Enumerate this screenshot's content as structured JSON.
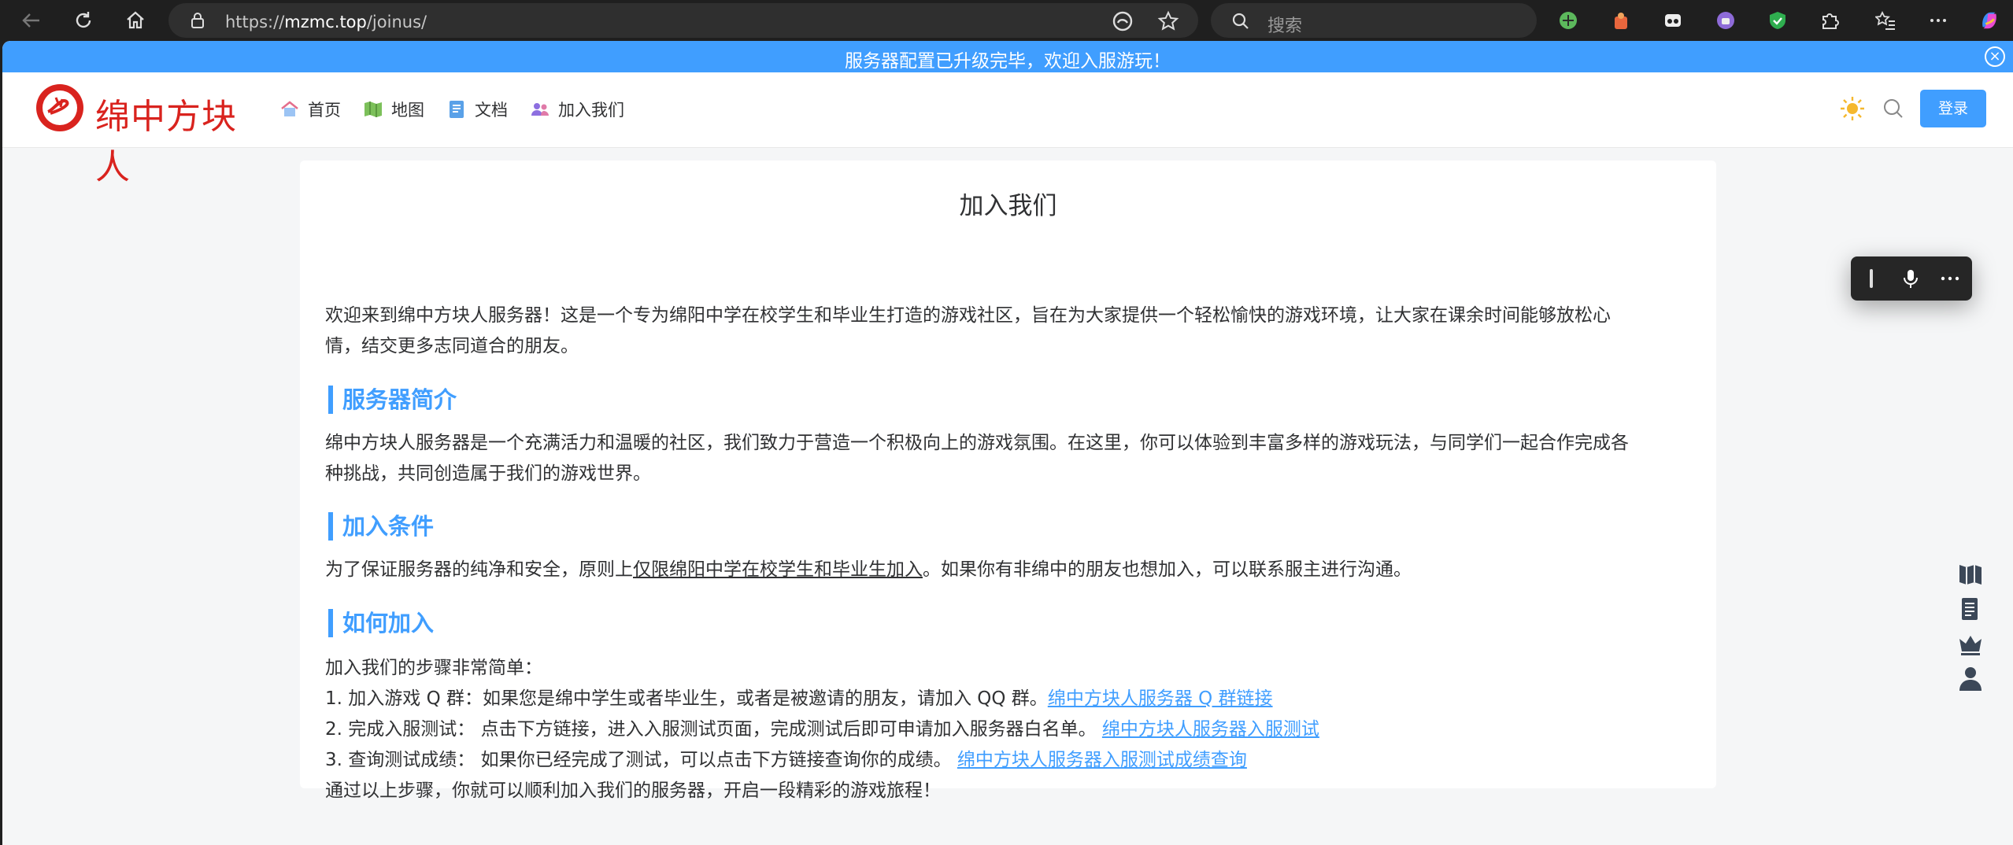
{
  "browser": {
    "url_prefix": "https://",
    "url_host": "mzmc.top",
    "url_path": "/joinus/",
    "search_placeholder": "搜索"
  },
  "announcement": {
    "text": "服务器配置已升级完毕，欢迎入服游玩！",
    "close_symbol": "×"
  },
  "site": {
    "logo_text": "绵中方块人",
    "nav": [
      {
        "label": "首页",
        "icon": "home-icon"
      },
      {
        "label": "地图",
        "icon": "map-icon"
      },
      {
        "label": "文档",
        "icon": "document-icon"
      },
      {
        "label": "加入我们",
        "icon": "people-icon"
      }
    ],
    "login_label": "登录"
  },
  "article": {
    "title": "加入我们",
    "intro_line1": "欢迎来到绵中方块人服务器！这是一个专为绵阳中学在校学生和毕业生打造的游戏社区，旨在为大家提供一个轻松愉快的游戏环境，让大家在课余时间能够放松心",
    "intro_line2": "情，结交更多志同道合的朋友。",
    "section1_title": "服务器简介",
    "section1_line1": "绵中方块人服务器是一个充满活力和温暖的社区，我们致力于营造一个积极向上的游戏氛围。在这里，你可以体验到丰富多样的游戏玩法，与同学们一起合作完成各",
    "section1_line2": "种挑战，共同创造属于我们的游戏世界。",
    "section2_title": "加入条件",
    "section2_pre": "为了保证服务器的纯净和安全，原则上",
    "section2_underline": "仅限绵阳中学在校学生和毕业生加入",
    "section2_post": "。如果你有非绵中的朋友也想加入，可以联系服主进行沟通。",
    "section3_title": "如何加入",
    "steps_intro": "加入我们的步骤非常简单：",
    "step1_text": "1. 加入游戏 Q 群：如果您是绵中学生或者毕业生，或者是被邀请的朋友，请加入 QQ 群。",
    "step1_link": "绵中方块人服务器 Q 群链接",
    "step2_text": "2. 完成入服测试： 点击下方链接，进入入服测试页面，完成测试后即可申请加入服务器白名单。",
    "step2_link": "绵中方块人服务器入服测试",
    "step3_text": "3. 查询测试成绩： 如果你已经完成了测试，可以点击下方链接查询你的成绩。",
    "step3_link": "绵中方块人服务器入服测试成绩查询",
    "outro": "通过以上步骤，你就可以顺利加入我们的服务器，开启一段精彩的游戏旅程！"
  },
  "colors": {
    "accent": "#409eff",
    "logo_red": "#d9231e",
    "text": "#303133"
  }
}
